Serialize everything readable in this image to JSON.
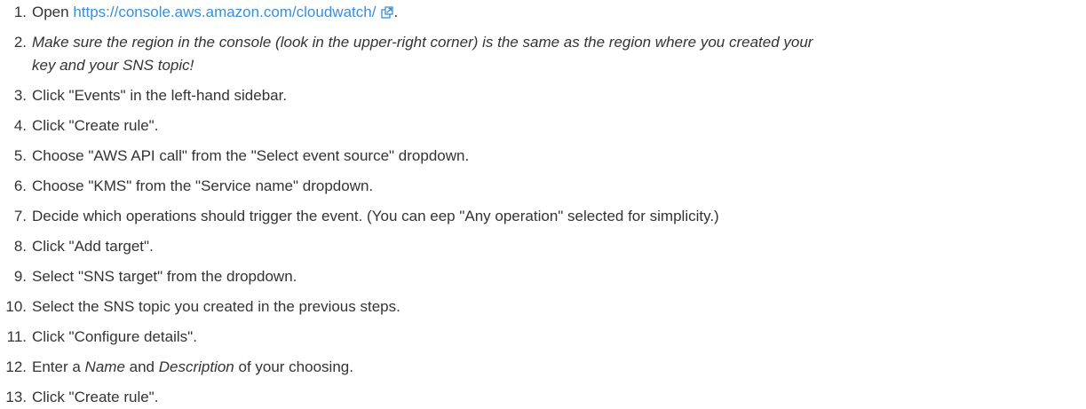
{
  "steps": [
    {
      "num": "1.",
      "prefix": "Open ",
      "link_text": "https://console.aws.amazon.com/cloudwatch/",
      "link_icon": "external-link-icon",
      "suffix": "."
    },
    {
      "num": "2.",
      "line1": "Make sure the region in the console (look in the upper-right corner) is the same as the region where you created your",
      "line2": "key and your SNS topic!"
    },
    {
      "num": "3.",
      "text": "Click \"Events\" in the left-hand sidebar."
    },
    {
      "num": "4.",
      "text": "Click \"Create rule\"."
    },
    {
      "num": "5.",
      "text": "Choose \"AWS API call\" from the \"Select event source\" dropdown."
    },
    {
      "num": "6.",
      "text": "Choose \"KMS\" from the \"Service name\" dropdown."
    },
    {
      "num": "7.",
      "text": "Decide which operations should trigger the event. (You can eep \"Any operation\" selected for simplicity.)"
    },
    {
      "num": "8.",
      "text": "Click \"Add target\"."
    },
    {
      "num": "9.",
      "text": "Select \"SNS target\" from the dropdown."
    },
    {
      "num": "10.",
      "text": "Select the SNS topic you created in the previous steps."
    },
    {
      "num": "11.",
      "text": "Click \"Configure details\"."
    },
    {
      "num": "12.",
      "before": "Enter a ",
      "name_word": "Name",
      "middle": " and ",
      "desc_word": "Description",
      "after": " of your choosing."
    },
    {
      "num": "13.",
      "text": "Click \"Create rule\"."
    }
  ],
  "colors": {
    "text": "#333333",
    "link": "#3a8fd6"
  }
}
